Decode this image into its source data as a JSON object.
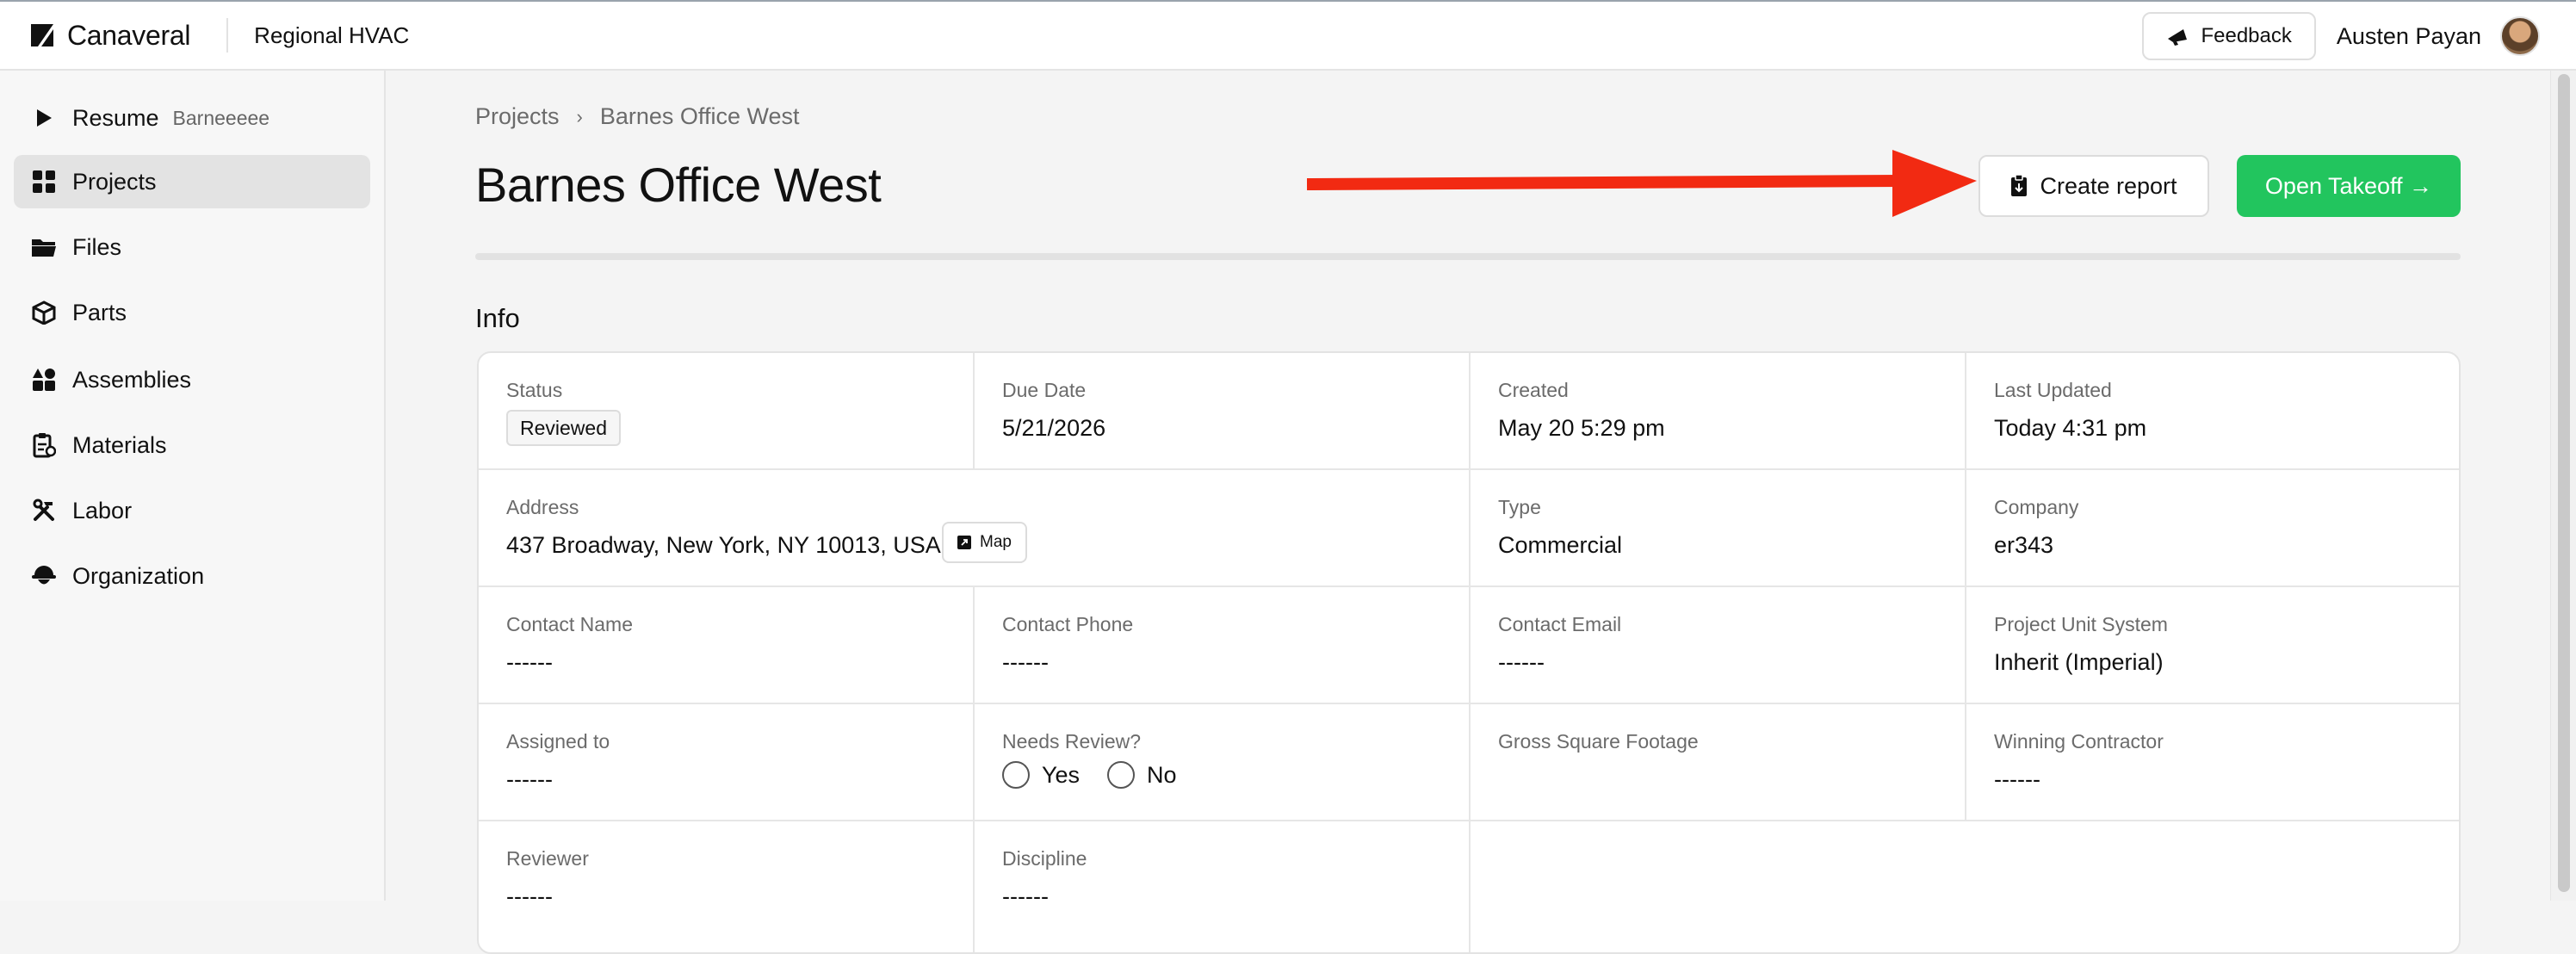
{
  "app": {
    "name": "Canaveral",
    "org": "Regional HVAC"
  },
  "header": {
    "feedback_label": "Feedback",
    "user_name": "Austen Payan"
  },
  "sidebar": {
    "items": [
      {
        "label": "Resume",
        "sub": "Barneeeee",
        "icon": "play-icon"
      },
      {
        "label": "Projects",
        "icon": "grid-icon",
        "active": true
      },
      {
        "label": "Files",
        "icon": "folder-icon"
      },
      {
        "label": "Parts",
        "icon": "box-icon"
      },
      {
        "label": "Assemblies",
        "icon": "shapes-icon"
      },
      {
        "label": "Materials",
        "icon": "clipboard-icon"
      },
      {
        "label": "Labor",
        "icon": "tools-icon"
      },
      {
        "label": "Organization",
        "icon": "hardhat-icon"
      }
    ]
  },
  "breadcrumb": {
    "parent": "Projects",
    "current": "Barnes Office West"
  },
  "page": {
    "title": "Barnes Office West",
    "create_report_label": "Create report",
    "open_takeoff_label": "Open Takeoff →",
    "section_title": "Info"
  },
  "colors": {
    "accent_green": "#22c55e",
    "annotation_arrow": "#f22a12"
  },
  "info": {
    "status": {
      "label": "Status",
      "value": "Reviewed"
    },
    "due_date": {
      "label": "Due Date",
      "value": "5/21/2026"
    },
    "created": {
      "label": "Created",
      "value": "May 20 5:29 pm"
    },
    "last_updated": {
      "label": "Last Updated",
      "value": "Today 4:31 pm"
    },
    "address": {
      "label": "Address",
      "value": "437 Broadway, New York, NY 10013, USA",
      "map_label": "Map"
    },
    "type": {
      "label": "Type",
      "value": "Commercial"
    },
    "company": {
      "label": "Company",
      "value": "er343"
    },
    "contact_name": {
      "label": "Contact Name",
      "value": "------"
    },
    "contact_phone": {
      "label": "Contact Phone",
      "value": "------"
    },
    "contact_email": {
      "label": "Contact Email",
      "value": "------"
    },
    "unit_system": {
      "label": "Project Unit System",
      "value": "Inherit (Imperial)"
    },
    "assigned_to": {
      "label": "Assigned to",
      "value": "------"
    },
    "needs_review": {
      "label": "Needs Review?",
      "yes": "Yes",
      "no": "No"
    },
    "gross_sqft": {
      "label": "Gross Square Footage"
    },
    "winning_contractor": {
      "label": "Winning Contractor",
      "value": "------"
    },
    "reviewer": {
      "label": "Reviewer",
      "value": "------"
    },
    "discipline": {
      "label": "Discipline",
      "value": "------"
    }
  }
}
